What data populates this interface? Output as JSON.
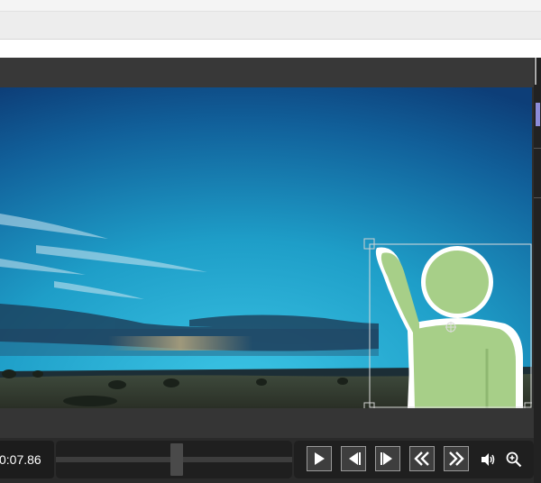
{
  "player": {
    "timecode": "0:07.86",
    "scrub_progress": 0.51,
    "controls": [
      {
        "name": "play-icon"
      },
      {
        "name": "step-back-icon"
      },
      {
        "name": "step-forward-icon"
      },
      {
        "name": "rewind-icon"
      },
      {
        "name": "fast-forward-icon"
      },
      {
        "name": "volume-icon"
      },
      {
        "name": "zoom-in-icon"
      }
    ]
  },
  "colors": {
    "sky_top": "#0d3e78",
    "sky_mid": "#1e9ec8",
    "figure": "#a7cf88",
    "accent": "#8c8cd8"
  }
}
